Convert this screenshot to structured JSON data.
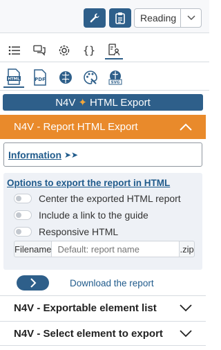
{
  "toolbar": {
    "wrench_icon": "wrench-icon",
    "clipboard_icon": "clipboard-icon",
    "mode_value": "Reading"
  },
  "tabs": [
    "list-icon",
    "comments-icon",
    "settings-icon",
    "code-icon",
    "user-doc-icon"
  ],
  "formats": [
    "html-file-icon",
    "pdf-file-icon",
    "brain-icon",
    "palette-icon",
    "svg-brain-icon"
  ],
  "banner": {
    "left": "N4V",
    "star": "✦",
    "right": "HTML Export"
  },
  "report_export": {
    "title": "N4V - Report HTML Export",
    "information_link": "Information",
    "information_chevrons": "➤➤",
    "options_title": "Options to export the report in HTML",
    "options": [
      {
        "label": "Center the exported HTML report",
        "enabled": false
      },
      {
        "label": "Include a link to the guide",
        "enabled": false
      },
      {
        "label": "Responsive HTML",
        "enabled": false
      }
    ],
    "filename_label": "Filename",
    "filename_placeholder": "Default: report name",
    "filename_ext": ".zip",
    "download_label": "Download the report"
  },
  "sections": {
    "exportable_list": "N4V - Exportable element list",
    "select_element": "N4V - Select element to export"
  },
  "colors": {
    "primary": "#2e5f8a",
    "accent": "#e98a2b",
    "link": "#1f5a8b"
  }
}
